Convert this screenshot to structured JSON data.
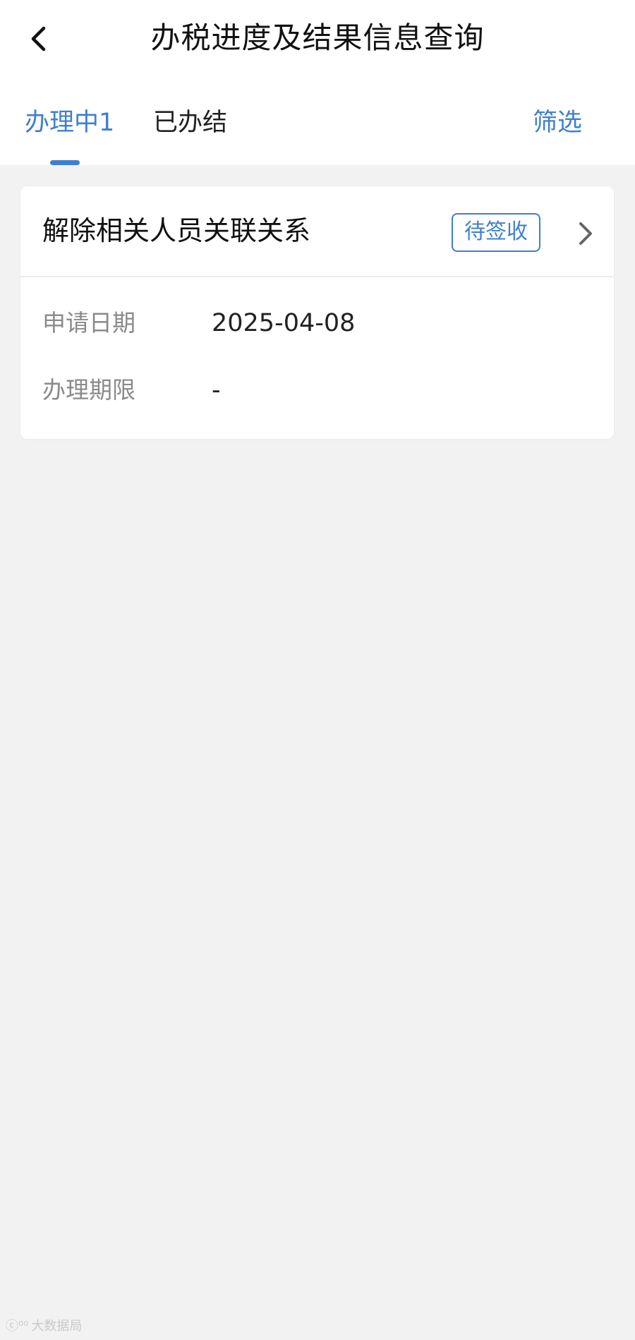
{
  "header": {
    "title": "办税进度及结果信息查询",
    "back_icon": "chevron-left-icon"
  },
  "tabs": [
    {
      "label": "办理中1",
      "active": true
    },
    {
      "label": "已办结",
      "active": false
    }
  ],
  "filter_label": "筛选",
  "colors": {
    "accent": "#3f7fcf",
    "background": "#f2f2f2",
    "card": "#ffffff"
  },
  "card": {
    "title": "解除相关人员关联关系",
    "status": "待签收",
    "fields": [
      {
        "label": "申请日期",
        "value": "2025-04-08"
      },
      {
        "label": "办理期限",
        "value": "-"
      }
    ]
  },
  "watermark": {
    "logo": "ⓒ⁰⁰",
    "text": "大数据局"
  }
}
